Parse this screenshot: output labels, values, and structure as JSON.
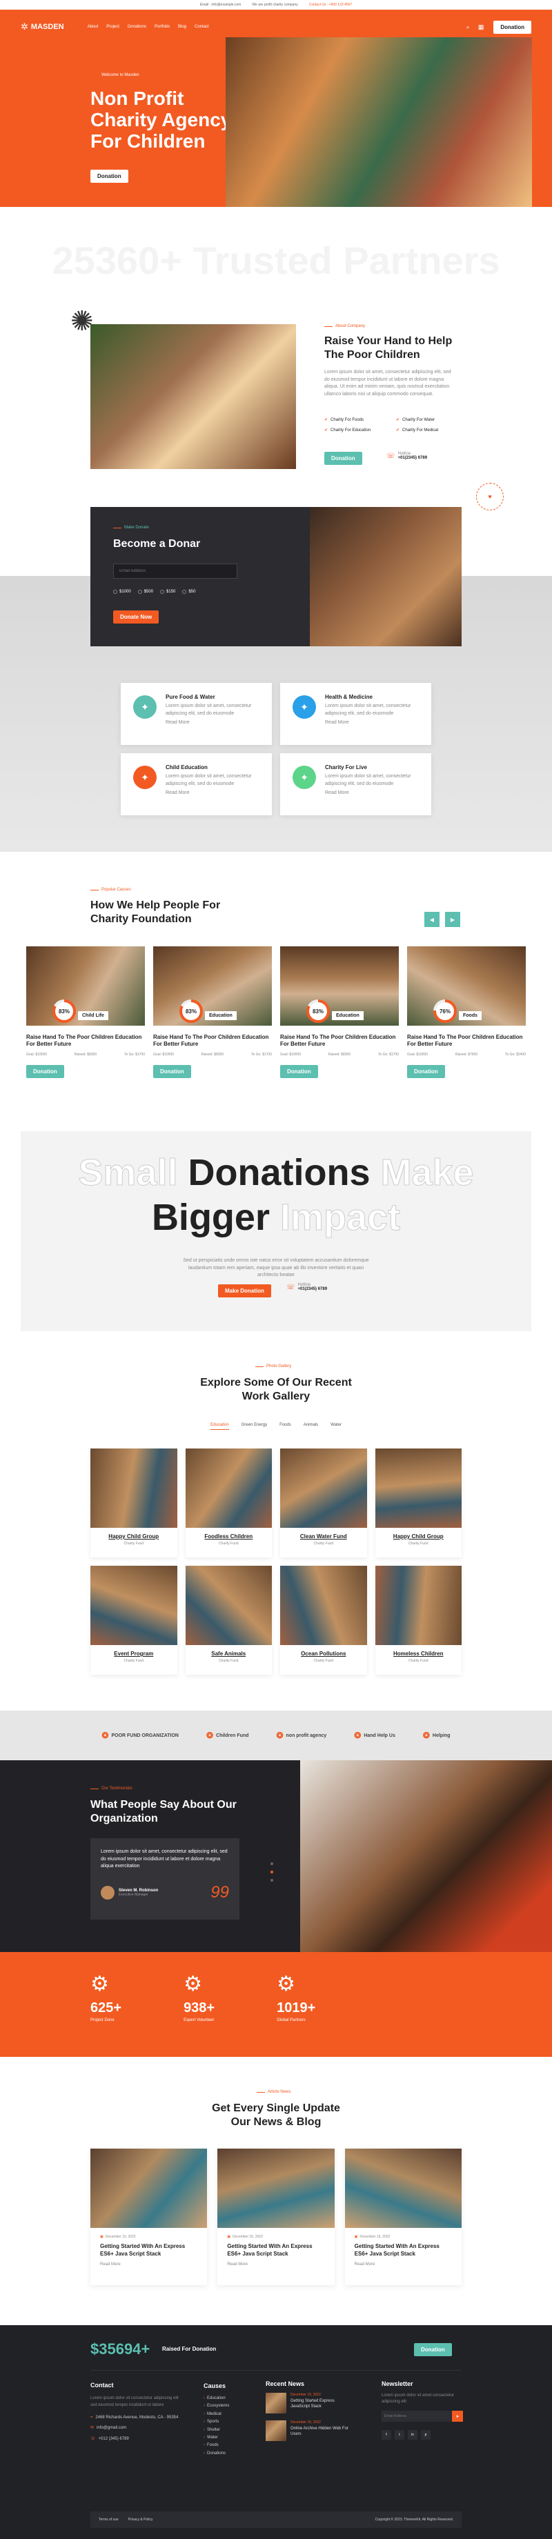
{
  "topbar": {
    "email": "Email : info@example.com",
    "notice": "We are profit charity company",
    "contact": "Contact Us : +000 123 4567"
  },
  "nav": {
    "logo": "MASDEN",
    "items": [
      "About",
      "Project",
      "Donations",
      "Portfolio",
      "Blog",
      "Contact"
    ],
    "donate": "Donation"
  },
  "hero": {
    "tag": "Welcome to Masden",
    "title_lines": [
      "Non Profit",
      "Charity Agency",
      "For Children"
    ],
    "button": "Donation"
  },
  "trusted": {
    "text": "25360+ Trusted Partners"
  },
  "about": {
    "tag": "About Company",
    "title_lines": [
      "Raise Your Hand to Help",
      "The Poor Children"
    ],
    "body": "Lorem ipsum dolor sit amet, consectetur adipiscing elit, sed do eiusmod tempor incididunt ut labore et dolore magna aliqua. Ut enim ad minim veniam, quis nostrud exercitation ullamco laboris nisi ut aliquip commodo consequat.",
    "features": [
      "Charity For Foods",
      "Charity For Water",
      "Charity For Education",
      "Charity For Medical"
    ],
    "button": "Donation",
    "hotline_label": "Hotline",
    "hotline": "+01(2345) 6789"
  },
  "donor": {
    "tag": "Make Donate",
    "title": "Become a Donar",
    "email_placeholder": "Email Address",
    "amounts": [
      "$1000",
      "$500",
      "$150",
      "$50"
    ],
    "button": "Donate Now"
  },
  "services": [
    {
      "title": "Pure Food & Water",
      "body": "Lorem ipsum dolor sit amet, consectetur adipiscing elit, sed do eiusmode",
      "link": "Read More",
      "icon": "water-icon",
      "color": "#5cbfb0"
    },
    {
      "title": "Health & Medicine",
      "body": "Lorem ipsum dolor sit amet, consectetur adipiscing elit, sed do eiusmode",
      "link": "Read More",
      "icon": "medicine-icon",
      "color": "#2aa0e8"
    },
    {
      "title": "Child Education",
      "body": "Lorem ipsum dolor sit amet, consectetur adipiscing elit, sed do eiusmode",
      "link": "Read More",
      "icon": "education-icon",
      "color": "#f25a22"
    },
    {
      "title": "Charity For Live",
      "body": "Lorem ipsum dolor sit amet, consectetur adipiscing elit, sed do eiusmode",
      "link": "Read More",
      "icon": "heart-hand-icon",
      "color": "#5cd48a"
    }
  ],
  "causes": {
    "tag": "Popular Causes",
    "title_lines": [
      "How We Help People For",
      "Charity Foundation"
    ],
    "items": [
      {
        "badge": "Child Life",
        "pct": "83%",
        "pct_value": 83,
        "title": "Raise Hand To The Poor Children Education For Better Future",
        "goal": "Goal: $10000",
        "raised": "Raised: $8300",
        "to_go": "To Go: $1700",
        "button": "Donation"
      },
      {
        "badge": "Education",
        "pct": "83%",
        "pct_value": 83,
        "title": "Raise Hand To The Poor Children Education For Better Future",
        "goal": "Goal: $10000",
        "raised": "Raised: $8300",
        "to_go": "To Go: $1700",
        "button": "Donation"
      },
      {
        "badge": "Education",
        "pct": "83%",
        "pct_value": 83,
        "title": "Raise Hand To The Poor Children Education For Better Future",
        "goal": "Goal: $10000",
        "raised": "Raised: $8300",
        "to_go": "To Go: $1700",
        "button": "Donation"
      },
      {
        "badge": "Foods",
        "pct": "76%",
        "pct_value": 76,
        "title": "Raise Hand To The Poor Children Education For Better Future",
        "goal": "Goal: $10000",
        "raised": "Raised: $7600",
        "to_go": "To Go: $2400",
        "button": "Donation"
      }
    ]
  },
  "big": {
    "w1": "Small",
    "w2": "Donations",
    "w3": "Make",
    "w4": "Bigger",
    "w5": "Impact",
    "body": "Sed ut perspiciatis unde omnis iste natus error sit voluptatem accusantium doloremque laudantium totam rem aperiam, eaque ipsa quae ab illo inventore veritatis et quasi architecto beatae",
    "button": "Make Donation",
    "hotline_label": "Hotline",
    "hotline": "+01(2345) 6789"
  },
  "gallery": {
    "tag": "Photo Gallery",
    "title_lines": [
      "Explore Some Of Our Recent",
      "Work Gallery"
    ],
    "tabs": [
      "Education",
      "Green Energy",
      "Foods",
      "Animals",
      "Water"
    ],
    "items": [
      {
        "title": "Happy Child Group",
        "sub": "Charity Fund"
      },
      {
        "title": "Foodless Children",
        "sub": "Charity Fund"
      },
      {
        "title": "Clean Water Fund",
        "sub": "Charity Fund"
      },
      {
        "title": "Happy Child Group",
        "sub": "Charity Fund"
      },
      {
        "title": "Event Program",
        "sub": "Charity Fund"
      },
      {
        "title": "Safe Animals",
        "sub": "Charity Fund"
      },
      {
        "title": "Ocean Pollutions",
        "sub": "Charity Fund"
      },
      {
        "title": "Homeless Children",
        "sub": "Charity Fund"
      }
    ]
  },
  "partners": [
    "POOR FUND ORGANIZATION",
    "Children Fund",
    "non profit agency",
    "Hand Help Us",
    "Helping"
  ],
  "testimonial": {
    "tag": "Our Testimonials",
    "title_lines": [
      "What People Say About Our",
      "Organization"
    ],
    "quote": "Lorem ipsum dolor sit amet, consectetur adipiscing elit, sed do eiusmod tempor incididunt ut labore et dolore magna aliqua exercitation",
    "name": "Steven M. Robinson",
    "role": "Executive Manager",
    "mark": "99"
  },
  "stats": [
    {
      "value": "625+",
      "label": "Project Done",
      "icon": "project-icon"
    },
    {
      "value": "938+",
      "label": "Expert Volunteer",
      "icon": "volunteer-icon"
    },
    {
      "value": "1019+",
      "label": "Global Partners",
      "icon": "partners-icon"
    }
  ],
  "news": {
    "tag": "Article News",
    "title_lines": [
      "Get Every Single Update",
      "Our News & Blog"
    ],
    "items": [
      {
        "date": "December 15, 2022",
        "title": "Getting Started With An Express ES6+ Java Script Stack",
        "link": "Read More"
      },
      {
        "date": "December 15, 2022",
        "title": "Getting Started With An Express ES6+ Java Script Stack",
        "link": "Read More"
      },
      {
        "date": "December 15, 2022",
        "title": "Getting Started With An Express ES6+ Java Script Stack",
        "link": "Read More"
      }
    ]
  },
  "footer": {
    "raised": "$35694+",
    "raised_label": "Raised For Donation",
    "donate": "Donation",
    "contact_title": "Contact",
    "contact_body": "Lorem ipsum dolor sit consectetur adipiscing elit sed eiusmod tempor incididunt ut labore",
    "address": "2468 Richards Avenue, Modesto, CA - 95354",
    "email": "info@gmail.com",
    "phone": "+012 (345) 6789",
    "causes_title": "Causes",
    "causes": [
      "Education",
      "Ecosystems",
      "Medical",
      "Sports",
      "Shelter",
      "Water",
      "Foods",
      "Donations"
    ],
    "news_title": "Recent News",
    "news": [
      {
        "date": "December 15, 2022",
        "title": "Getting Started Express JavaScript Stack"
      },
      {
        "date": "December 15, 2022",
        "title": "Online Archive Hidden Web For Users"
      }
    ],
    "newsletter_title": "Newsletter",
    "newsletter_body": "Lorem ipsum dolor sit amet consectetur adipiscing elit",
    "newsletter_placeholder": "Email Address",
    "socials": [
      "f",
      "t",
      "in",
      "p"
    ],
    "bottom_links": [
      "Terms of use",
      "Privacy & Policy"
    ],
    "copyright": "Copyright © 2023. ThemesKit. All Rights Reserved."
  }
}
